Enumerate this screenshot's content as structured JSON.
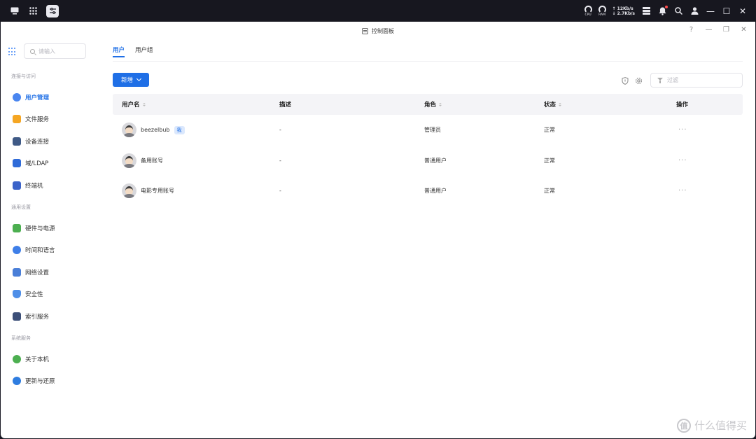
{
  "sysbar": {
    "cpu_label": "CPU",
    "ram_label": "RAM",
    "upload": "↑ 12Kb/s",
    "download": "↓ 2.7Kb/s"
  },
  "window": {
    "title": "控制面板",
    "help": "?",
    "minimize": "—",
    "restore": "❐",
    "close": "✕"
  },
  "sidebar": {
    "search_placeholder": "请输入",
    "sections": [
      {
        "title": "连接与访问"
      },
      {
        "title": "通用设置"
      },
      {
        "title": "系统服务"
      }
    ],
    "items": [
      {
        "label": "用户管理",
        "icon": "user-icon",
        "color": "#4a86f0"
      },
      {
        "label": "文件服务",
        "icon": "folder-icon",
        "color": "#f5a623"
      },
      {
        "label": "设备连接",
        "icon": "device-icon",
        "color": "#3f5a86"
      },
      {
        "label": "域/LDAP",
        "icon": "domain-icon",
        "color": "#2f6bd8"
      },
      {
        "label": "终端机",
        "icon": "terminal-icon",
        "color": "#3b63c9"
      },
      {
        "label": "硬件与电源",
        "icon": "hardware-icon",
        "color": "#4caf50"
      },
      {
        "label": "时间和语言",
        "icon": "clock-icon",
        "color": "#3f7fe8"
      },
      {
        "label": "网络设置",
        "icon": "network-icon",
        "color": "#4a7fd8"
      },
      {
        "label": "安全性",
        "icon": "shield-icon",
        "color": "#4f8fe8"
      },
      {
        "label": "索引服务",
        "icon": "index-icon",
        "color": "#3c4f78"
      },
      {
        "label": "关于本机",
        "icon": "info-icon",
        "color": "#4caf50"
      },
      {
        "label": "更新与还原",
        "icon": "update-icon",
        "color": "#2f7de0"
      }
    ]
  },
  "main": {
    "tabs": [
      {
        "label": "用户",
        "active": true
      },
      {
        "label": "用户组",
        "active": false
      }
    ],
    "add_button": "新增",
    "filter_placeholder": "过滤",
    "columns": [
      "用户名",
      "描述",
      "角色",
      "状态",
      "操作"
    ],
    "rows": [
      {
        "username": "beezelbub",
        "badge": "我",
        "description": "-",
        "role": "管理员",
        "status": "正常",
        "action": "···"
      },
      {
        "username": "备用账号",
        "badge": "",
        "description": "-",
        "role": "普通用户",
        "status": "正常",
        "action": "···"
      },
      {
        "username": "电影专用账号",
        "badge": "",
        "description": "-",
        "role": "普通用户",
        "status": "正常",
        "action": "···"
      }
    ]
  },
  "watermark": {
    "logo": "值",
    "text": "什么值得买"
  },
  "colors": {
    "accent": "#1f6fe6",
    "sysbar": "#17171f",
    "header_bg": "#f4f4f7"
  }
}
